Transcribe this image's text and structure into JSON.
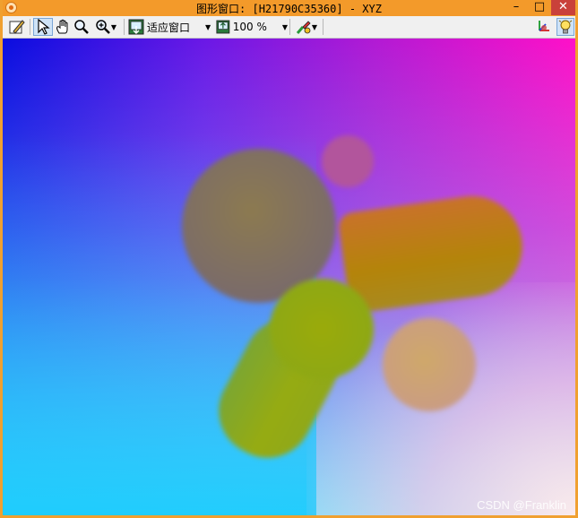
{
  "window": {
    "title": "图形窗口: [H21790C35360] - XYZ",
    "controls": {
      "minimize": "–",
      "maximize": "□",
      "close": "✕"
    }
  },
  "toolbar": {
    "items": [
      {
        "name": "edit-icon"
      },
      {
        "name": "pointer-icon",
        "active": true
      },
      {
        "name": "hand-icon"
      },
      {
        "name": "zoom-icon"
      },
      {
        "name": "zoom-in-icon",
        "dropdown": true
      },
      {
        "name": "fit-window-icon"
      },
      {
        "name": "zoom-percent-icon"
      },
      {
        "name": "color-picker-icon",
        "dropdown": true
      },
      {
        "name": "axes-icon"
      },
      {
        "name": "lightbulb-icon"
      }
    ],
    "fit_window_label": "适应窗口",
    "zoom_value": "100 %"
  },
  "canvas": {
    "description_colors": {
      "top_left": "#0a0de0",
      "top_right": "#ff10c8",
      "bottom_left": "#00f5ff",
      "bottom_right": "#fff0f0"
    }
  },
  "watermark": "CSDN @Franklin"
}
